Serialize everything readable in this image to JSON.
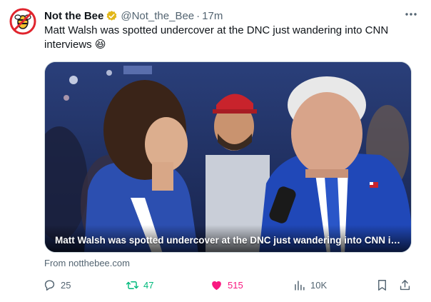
{
  "tweet": {
    "author": {
      "name": "Not the Bee",
      "handle": "@Not_the_Bee",
      "separator": "·",
      "time": "17m",
      "avatar_icon": "bee-logo-icon",
      "verified_icon": "verified-gold-badge-icon"
    },
    "text": "Matt Walsh was spotted undercover at the DNC just wandering into CNN interviews 😆",
    "media": {
      "caption": "Matt Walsh was spotted undercover at the DNC just wandering into CNN intervi..."
    },
    "source": "From notthebee.com",
    "actions": {
      "replies": "25",
      "retweets": "47",
      "likes": "515",
      "views": "10K"
    }
  },
  "icons": {
    "more": "more-horizontal-icon",
    "reply": "reply-icon",
    "retweet": "retweet-icon",
    "like": "heart-filled-icon",
    "views": "views-chart-icon",
    "bookmark": "bookmark-icon",
    "share": "share-icon"
  },
  "colors": {
    "brand_red": "#e0242d",
    "verified_gold": "#e2b719",
    "retweet_green": "#00ba7c",
    "like_pink": "#f91880",
    "muted_text": "#536471"
  }
}
